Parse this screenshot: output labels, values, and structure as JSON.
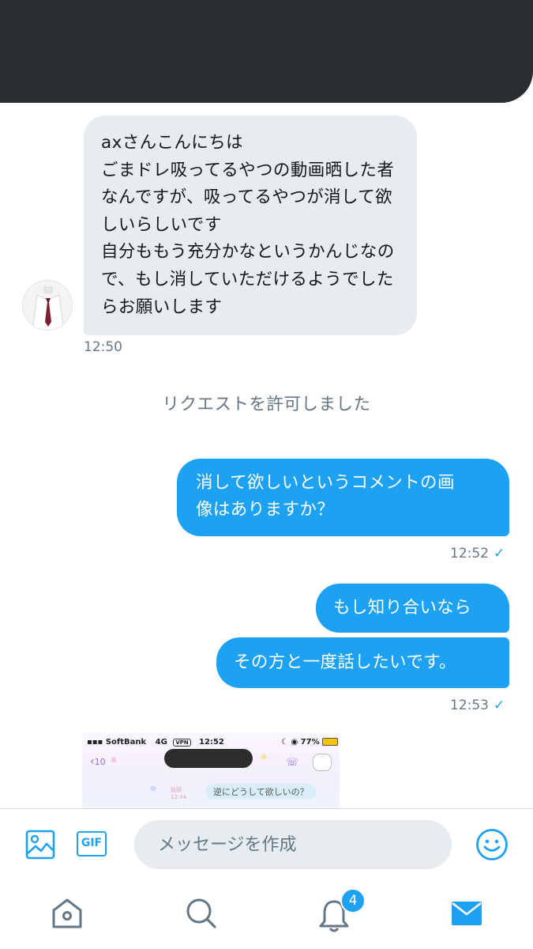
{
  "conversation": {
    "incoming_message": "axさんこんにちは\nごまドレ吸ってるやつの動画晒した者なんですが、吸ってるやつが消して欲しいらしいです\n自分ももう充分かなというかんじなので、もし消していただけるようでしたらお願いします",
    "incoming_time": "12:50",
    "system_notice": "リクエストを許可しました",
    "outgoing": [
      {
        "text": "消して欲しいというコメントの画\n像はありますか？",
        "time": "12:52"
      },
      {
        "text": "もし知り合いなら"
      },
      {
        "text": "その方と一度話したいです。",
        "time": "12:53"
      }
    ],
    "read_check": "✓"
  },
  "attachment": {
    "carrier": "SoftBank",
    "network": "4G",
    "vpn": "VPN",
    "time": "12:52",
    "battery": "77%",
    "back_label": "10",
    "bubble_text": "逆にどうして欲しいの？",
    "ghost_read": "既読",
    "ghost_time": "12:44"
  },
  "composer": {
    "placeholder": "メッセージを作成",
    "gif_label": "GIF"
  },
  "tabbar": {
    "notification_count": "4"
  },
  "colors": {
    "accent": "#1da1f2",
    "incoming_bubble": "#e6ecf0",
    "header": "#2a2e31"
  }
}
